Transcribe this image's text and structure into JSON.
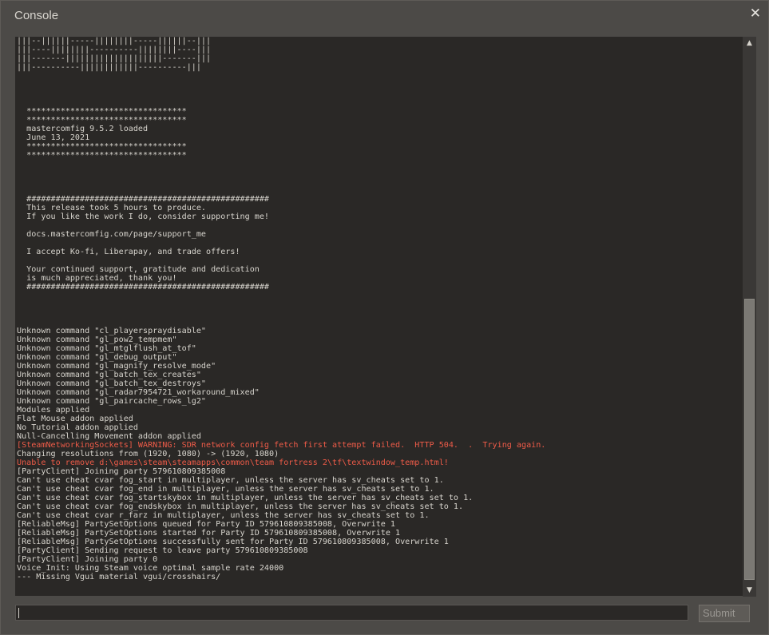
{
  "window": {
    "title": "Console",
    "close_glyph": "✕"
  },
  "log": [
    {
      "t": "|||--||||||-----||||||||-----||||||--|||"
    },
    {
      "t": "|||----||||||||----------||||||||----|||"
    },
    {
      "t": "|||-------||||||||||||||||||||-------|||"
    },
    {
      "t": "|||----------||||||||||||----------|||"
    },
    {
      "t": ""
    },
    {
      "t": ""
    },
    {
      "t": ""
    },
    {
      "t": ""
    },
    {
      "t": "  *********************************"
    },
    {
      "t": "  *********************************"
    },
    {
      "t": "  mastercomfig 9.5.2 loaded"
    },
    {
      "t": "  June 13, 2021"
    },
    {
      "t": "  *********************************"
    },
    {
      "t": "  *********************************"
    },
    {
      "t": ""
    },
    {
      "t": ""
    },
    {
      "t": ""
    },
    {
      "t": ""
    },
    {
      "t": "  ##################################################"
    },
    {
      "t": "  This release took 5 hours to produce."
    },
    {
      "t": "  If you like the work I do, consider supporting me!"
    },
    {
      "t": ""
    },
    {
      "t": "  docs.mastercomfig.com/page/support_me"
    },
    {
      "t": ""
    },
    {
      "t": "  I accept Ko-fi, Liberapay, and trade offers!"
    },
    {
      "t": ""
    },
    {
      "t": "  Your continued support, gratitude and dedication"
    },
    {
      "t": "  is much appreciated, thank you!"
    },
    {
      "t": "  ##################################################"
    },
    {
      "t": ""
    },
    {
      "t": ""
    },
    {
      "t": ""
    },
    {
      "t": ""
    },
    {
      "t": "Unknown command \"cl_playerspraydisable\""
    },
    {
      "t": "Unknown command \"gl_pow2_tempmem\""
    },
    {
      "t": "Unknown command \"gl_mtglflush_at_tof\""
    },
    {
      "t": "Unknown command \"gl_debug_output\""
    },
    {
      "t": "Unknown command \"gl_magnify_resolve_mode\""
    },
    {
      "t": "Unknown command \"gl_batch_tex_creates\""
    },
    {
      "t": "Unknown command \"gl_batch_tex_destroys\""
    },
    {
      "t": "Unknown command \"gl_radar7954721_workaround_mixed\""
    },
    {
      "t": "Unknown command \"gl_paircache_rows_lg2\""
    },
    {
      "t": "Modules applied"
    },
    {
      "t": "Flat Mouse addon applied"
    },
    {
      "t": "No Tutorial addon applied"
    },
    {
      "t": "Null-Cancelling Movement addon applied"
    },
    {
      "t": "[SteamNetworkingSockets] WARNING: SDR network config fetch first attempt failed.  HTTP 504.  .  Trying again.",
      "c": "err"
    },
    {
      "t": "Changing resolutions from (1920, 1080) -> (1920, 1080)"
    },
    {
      "t": "Unable to remove d:\\games\\steam\\steamapps\\common\\team fortress 2\\tf\\textwindow_temp.html!",
      "c": "err"
    },
    {
      "t": "[PartyClient] Joining party 579610809385008"
    },
    {
      "t": "Can't use cheat cvar fog_start in multiplayer, unless the server has sv_cheats set to 1."
    },
    {
      "t": "Can't use cheat cvar fog_end in multiplayer, unless the server has sv_cheats set to 1."
    },
    {
      "t": "Can't use cheat cvar fog_startskybox in multiplayer, unless the server has sv_cheats set to 1."
    },
    {
      "t": "Can't use cheat cvar fog_endskybox in multiplayer, unless the server has sv_cheats set to 1."
    },
    {
      "t": "Can't use cheat cvar r_farz in multiplayer, unless the server has sv_cheats set to 1."
    },
    {
      "t": "[ReliableMsg] PartySetOptions queued for Party ID 579610809385008, Overwrite 1"
    },
    {
      "t": "[ReliableMsg] PartySetOptions started for Party ID 579610809385008, Overwrite 1"
    },
    {
      "t": "[ReliableMsg] PartySetOptions successfully sent for Party ID 579610809385008, Overwrite 1"
    },
    {
      "t": "[PartyClient] Sending request to leave party 579610809385008"
    },
    {
      "t": "[PartyClient] Joining party 0"
    },
    {
      "t": "Voice_Init: Using Steam voice optimal sample rate 24000"
    },
    {
      "t": "--- Missing Vgui material vgui/crosshairs/"
    }
  ],
  "scrollbar": {
    "up_glyph": "▲",
    "down_glyph": "▼"
  },
  "input": {
    "value": "",
    "placeholder": ""
  },
  "submit_label": "Submit",
  "colors": {
    "error": "#ee5b48",
    "text": "#d7d4cd",
    "panel": "#2a2826"
  }
}
